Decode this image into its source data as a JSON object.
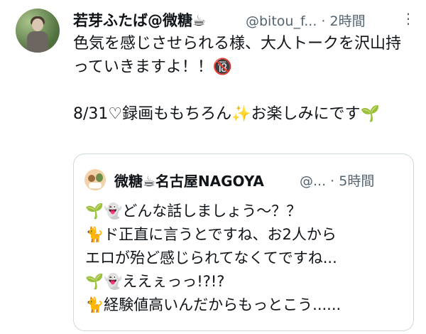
{
  "tweet": {
    "author_name": "若芽ふたば@微糖☕",
    "handle_time": "@bitou_f... · 2時間",
    "more_icon": "⋮",
    "text": "色気を感じさせられる様、大人トークを沢山持っていきますよ！！🔞\n\n8/31♡録画ももちろん✨お楽しみにです🌱"
  },
  "quote": {
    "author_name": "微糖☕名古屋NAGOYA",
    "handle_time": "@... · 5時間",
    "text": "🌱👻どんな話しましょう～？？\n🐈ド正直に言うとですね、お2人から\nエロが殆ど感じられてなくてですね...\n🌱👻ええぇっっ!?!?\n🐈経験値高いんだからもっとこう......"
  }
}
